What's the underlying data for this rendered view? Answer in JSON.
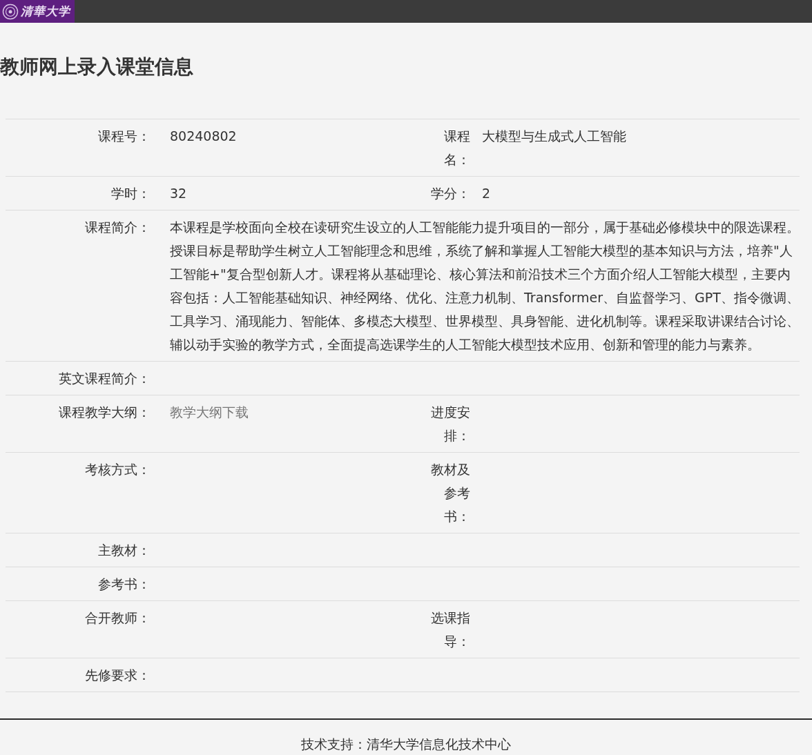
{
  "header": {
    "logo_text": "清華大学"
  },
  "page_title": "教师网上录入课堂信息",
  "rows": [
    {
      "cells": [
        {
          "label": "课程号：",
          "value": "80240802"
        },
        {
          "label": "课程名：",
          "value": "大模型与生成式人工智能"
        }
      ]
    },
    {
      "cells": [
        {
          "label": "学时：",
          "value": "32"
        },
        {
          "label": "学分：",
          "value": "2"
        }
      ]
    },
    {
      "cells": [
        {
          "label": "课程简介：",
          "value": "本课程是学校面向全校在读研究生设立的人工智能能力提升项目的一部分，属于基础必修模块中的限选课程。授课目标是帮助学生树立人工智能理念和思维，系统了解和掌握人工智能大模型的基本知识与方法，培养\"人工智能+\"复合型创新人才。课程将从基础理论、核心算法和前沿技术三个方面介绍人工智能大模型，主要内容包括：人工智能基础知识、神经网络、优化、注意力机制、Transformer、自监督学习、GPT、指令微调、工具学习、涌现能力、智能体、多模态大模型、世界模型、具身智能、进化机制等。课程采取讲课结合讨论、辅以动手实验的教学方式，全面提高选课学生的人工智能大模型技术应用、创新和管理的能力与素养。"
        }
      ]
    },
    {
      "cells": [
        {
          "label": "英文课程简介："
        }
      ]
    },
    {
      "cells": [
        {
          "label": "课程教学大纲：",
          "value": "教学大纲下载",
          "kind": "link"
        },
        {
          "label": "进度安排："
        }
      ]
    },
    {
      "cells": [
        {
          "label": "考核方式："
        },
        {
          "label": "教材及参考书："
        }
      ]
    },
    {
      "cells": [
        {
          "label": "主教材："
        }
      ]
    },
    {
      "cells": [
        {
          "label": "参考书："
        }
      ]
    },
    {
      "cells": [
        {
          "label": "合开教师："
        },
        {
          "label": "选课指导："
        }
      ]
    },
    {
      "cells": [
        {
          "label": "先修要求："
        }
      ]
    }
  ],
  "footer": "技术支持：清华大学信息化技术中心"
}
